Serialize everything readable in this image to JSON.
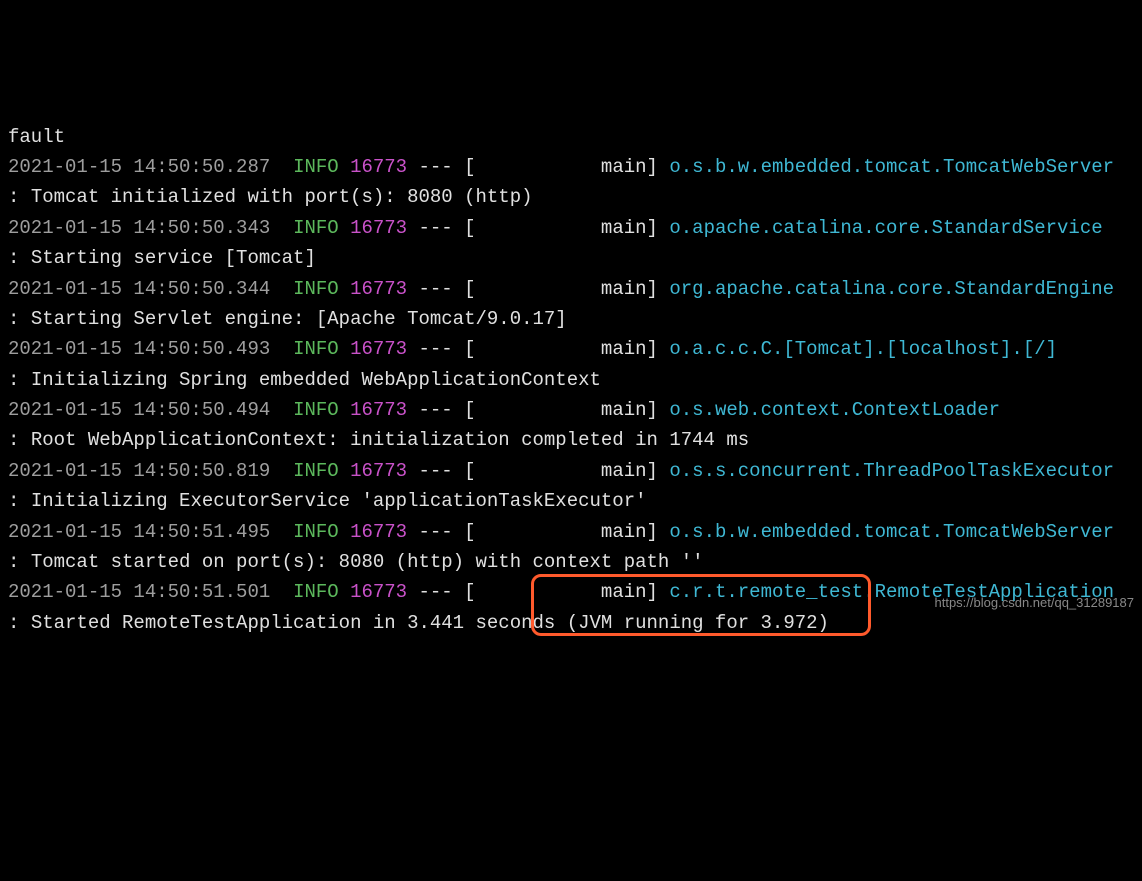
{
  "truncated_top": "fault",
  "lines": [
    {
      "ts": "2021-01-15 14:50:50.287",
      "level": "INFO",
      "pid": "16773",
      "sep": " --- [",
      "thread": "           main] ",
      "logger": "o.s.b.w.embedded.tomcat.TomcatWebServer",
      "colon": "   : ",
      "msg": "Tomcat initialized with port(s): 8080 (http)"
    },
    {
      "ts": "2021-01-15 14:50:50.343",
      "level": "INFO",
      "pid": "16773",
      "sep": " --- [",
      "thread": "           main] ",
      "logger": "o.apache.catalina.core.StandardService",
      "colon": "   : ",
      "msg": "Starting service [Tomcat]"
    },
    {
      "ts": "2021-01-15 14:50:50.344",
      "level": "INFO",
      "pid": "16773",
      "sep": " --- [",
      "thread": "           main] ",
      "logger": "org.apache.catalina.core.StandardEngine",
      "colon": "  : ",
      "msg": "Starting Servlet engine: [Apache Tomcat/9.0.17]"
    },
    {
      "ts": "2021-01-15 14:50:50.493",
      "level": "INFO",
      "pid": "16773",
      "sep": " --- [",
      "thread": "           main] ",
      "logger": "o.a.c.c.C.[Tomcat].[localhost].[/]",
      "colon": "       : ",
      "msg": "Initializing Spring embedded WebApplicationContext"
    },
    {
      "ts": "2021-01-15 14:50:50.494",
      "level": "INFO",
      "pid": "16773",
      "sep": " --- [",
      "thread": "           main] ",
      "logger": "o.s.web.context.ContextLoader",
      "colon": "            : ",
      "msg": "Root WebApplicationContext: initialization completed in 1744 ms"
    },
    {
      "ts": "2021-01-15 14:50:50.819",
      "level": "INFO",
      "pid": "16773",
      "sep": " --- [",
      "thread": "           main] ",
      "logger": "o.s.s.concurrent.ThreadPoolTaskExecutor",
      "colon": "  : ",
      "msg": "Initializing ExecutorService 'applicationTaskExecutor'"
    },
    {
      "ts": "2021-01-15 14:50:51.495",
      "level": "INFO",
      "pid": "16773",
      "sep": " --- [",
      "thread": "           main] ",
      "logger": "o.s.b.w.embedded.tomcat.TomcatWebServer",
      "colon": "  : ",
      "msg": "Tomcat started on port(s): 8080 (http) with context path ''"
    },
    {
      "ts": "2021-01-15 14:50:51.501",
      "level": "INFO",
      "pid": "16773",
      "sep": " --- [",
      "thread": "           main] ",
      "logger": "c.r.t.remote_test.RemoteTestApplication",
      "colon": "  : ",
      "msg": "Started RemoteTestApplication in 3.441 seconds (JVM running for 3.972)"
    }
  ],
  "watermark": "https://blog.csdn.net/qq_31289187",
  "colors": {
    "background": "#000000",
    "white": "#e0e0e0",
    "green": "#5cb85c",
    "magenta": "#c952c9",
    "cyan": "#3fb8d4",
    "gray": "#9e9e9e",
    "highlight": "#ff5a2c"
  }
}
